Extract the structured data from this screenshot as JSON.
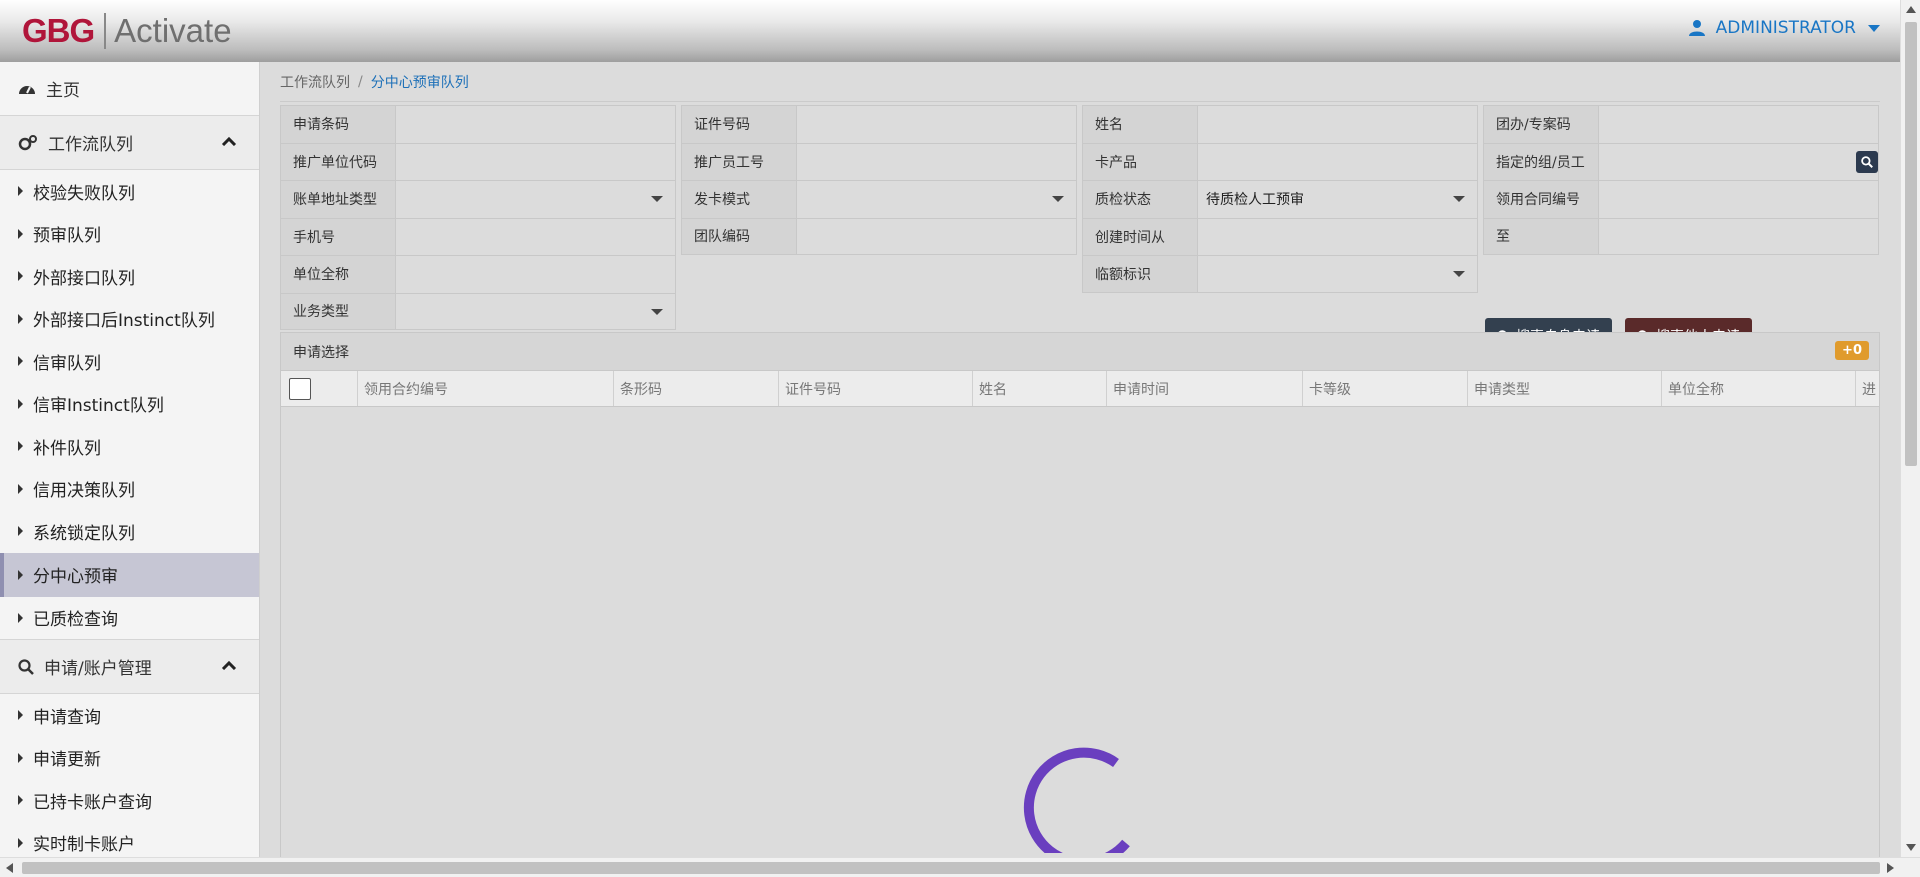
{
  "header": {
    "logo_left": "GBG",
    "logo_right": "Activate",
    "user_label": "ADMINISTRATOR",
    "accent_color": "#1976c5"
  },
  "sidebar": {
    "home": "主页",
    "workflow_section": "工作流队列",
    "workflow_items": [
      "校验失败队列",
      "预审队列",
      "外部接口队列",
      "外部接口后Instinct队列",
      "信审队列",
      "信审Instinct队列",
      "补件队列",
      "信用决策队列",
      "系统锁定队列",
      "分中心预审",
      "已质检查询"
    ],
    "active_item": "分中心预审",
    "account_section": "申请/账户管理",
    "account_items": [
      "申请查询",
      "申请更新",
      "已持卡账户查询",
      "实时制卡账户"
    ]
  },
  "breadcrumb": {
    "parent": "工作流队列",
    "separator": "/",
    "current": "分中心预审队列"
  },
  "form": {
    "col1": [
      {
        "label": "申请条码",
        "value": "",
        "dropdown": false
      },
      {
        "label": "推广单位代码",
        "value": "",
        "dropdown": false
      },
      {
        "label": "账单地址类型",
        "value": "",
        "dropdown": true
      },
      {
        "label": "手机号",
        "value": "",
        "dropdown": false
      },
      {
        "label": "单位全称",
        "value": "",
        "dropdown": false
      },
      {
        "label": "业务类型",
        "value": "",
        "dropdown": true
      }
    ],
    "col2": [
      {
        "label": "证件号码",
        "value": "",
        "dropdown": false
      },
      {
        "label": "推广员工号",
        "value": "",
        "dropdown": false
      },
      {
        "label": "发卡模式",
        "value": "",
        "dropdown": true
      },
      {
        "label": "团队编码",
        "value": "",
        "dropdown": false
      }
    ],
    "col3": [
      {
        "label": "姓名",
        "value": "",
        "dropdown": false
      },
      {
        "label": "卡产品",
        "value": "",
        "dropdown": false
      },
      {
        "label": "质检状态",
        "value": "待质检人工预审",
        "dropdown": true
      },
      {
        "label": "创建时间从",
        "value": "",
        "dropdown": false
      },
      {
        "label": "临额标识",
        "value": "",
        "dropdown": true
      }
    ],
    "col4": [
      {
        "label": "团办/专案码",
        "value": "",
        "dropdown": false
      },
      {
        "label": "指定的组/员工",
        "value": "",
        "dropdown": false
      },
      {
        "label": "领用合同编号",
        "value": "",
        "dropdown": false
      },
      {
        "label": "至",
        "value": "",
        "dropdown": false
      }
    ],
    "search_self": "搜索自身申请",
    "search_other": "搜索他人申请"
  },
  "panel": {
    "title": "申请选择",
    "badge": "+0",
    "columns": [
      "领用合约编号",
      "条形码",
      "证件号码",
      "姓名",
      "申请时间",
      "卡等级",
      "申请类型",
      "单位全称",
      "进"
    ]
  },
  "colors": {
    "spinner": "#6a3fbf",
    "btn_self": "#33404f",
    "btn_other": "#5a2a2a",
    "badge": "#e09b2d"
  }
}
